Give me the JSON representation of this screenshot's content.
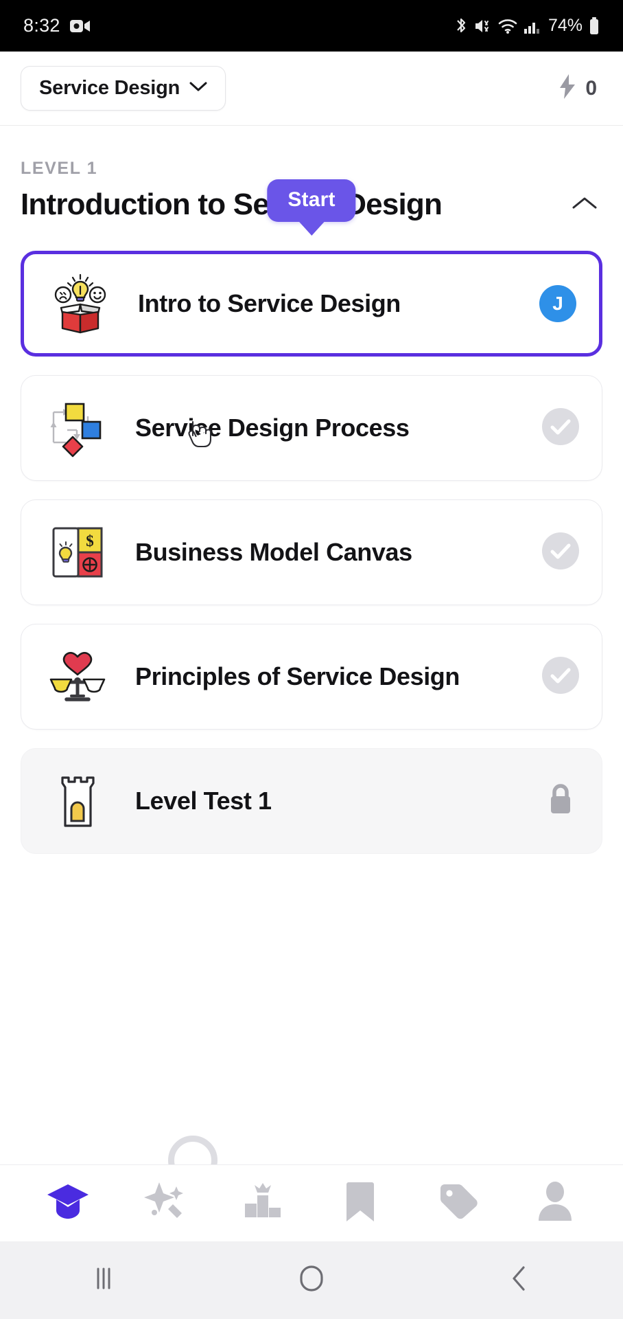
{
  "status_bar": {
    "time": "8:32",
    "battery_percent": "74%",
    "icons": [
      "screen-record-icon",
      "bluetooth-icon",
      "mute-icon",
      "wifi-icon",
      "signal-icon",
      "battery-icon"
    ]
  },
  "header": {
    "course_label": "Service Design",
    "course_chevron": "chevron-down-icon",
    "streak_icon": "lightning-bolt-icon",
    "streak_count": "0"
  },
  "section": {
    "level_label": "LEVEL 1",
    "title": "Introduction to Service Design",
    "collapse_icon": "chevron-up-icon"
  },
  "tooltip": {
    "label": "Start"
  },
  "lessons": [
    {
      "title": "Intro to Service Design",
      "icon": "idea-box-icon",
      "state": "active",
      "trailing": "avatar",
      "avatar_initial": "J"
    },
    {
      "title": "Service Design Process",
      "icon": "flowchart-icon",
      "state": "default",
      "trailing": "check-circle-icon"
    },
    {
      "title": "Business Model Canvas",
      "icon": "canvas-grid-icon",
      "state": "default",
      "trailing": "check-circle-icon"
    },
    {
      "title": "Principles of Service Design",
      "icon": "balance-scale-heart-icon",
      "state": "default",
      "trailing": "check-circle-icon"
    },
    {
      "title": "Level Test 1",
      "icon": "castle-tower-icon",
      "state": "locked",
      "trailing": "lock-icon"
    }
  ],
  "bottom_nav": [
    {
      "name": "learn",
      "icon": "graduation-cap-icon",
      "active": true
    },
    {
      "name": "practice",
      "icon": "magic-stars-icon",
      "active": false
    },
    {
      "name": "leaderboard",
      "icon": "podium-crown-icon",
      "active": false
    },
    {
      "name": "bookmarks",
      "icon": "bookmark-icon",
      "active": false
    },
    {
      "name": "offers",
      "icon": "tag-icon",
      "active": false
    },
    {
      "name": "profile",
      "icon": "person-icon",
      "active": false
    }
  ],
  "android_nav": [
    {
      "name": "recents",
      "icon": "recents-icon"
    },
    {
      "name": "home",
      "icon": "home-icon"
    },
    {
      "name": "back",
      "icon": "back-icon"
    }
  ],
  "colors": {
    "accent_purple": "#5A2FE0",
    "tooltip_purple": "#6a55e8",
    "avatar_blue": "#2E90E8",
    "muted_gray": "#d9d9de",
    "locked_bg": "#f6f6f7"
  }
}
